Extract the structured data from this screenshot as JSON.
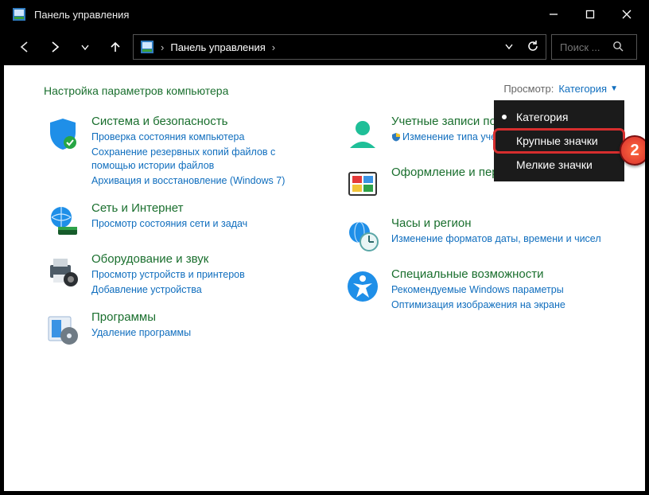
{
  "window": {
    "title": "Панель управления"
  },
  "address": {
    "location": "Панель управления",
    "sep": "›"
  },
  "search": {
    "placeholder": "Поиск ..."
  },
  "page": {
    "heading": "Настройка параметров компьютера",
    "view_label": "Просмотр:",
    "view_value": "Категория"
  },
  "dropdown": {
    "opt1": "Категория",
    "opt2": "Крупные значки",
    "opt3": "Мелкие значки"
  },
  "badge": {
    "num": "2"
  },
  "left": {
    "c1": {
      "title": "Система и безопасность",
      "l1": "Проверка состояния компьютера",
      "l2": "Сохранение резервных копий файлов с помощью истории файлов",
      "l3": "Архивация и восстановление (Windows 7)"
    },
    "c2": {
      "title": "Сеть и Интернет",
      "l1": "Просмотр состояния сети и задач"
    },
    "c3": {
      "title": "Оборудование и звук",
      "l1": "Просмотр устройств и принтеров",
      "l2": "Добавление устройства"
    },
    "c4": {
      "title": "Программы",
      "l1": "Удаление программы"
    }
  },
  "right": {
    "c1": {
      "title": "Учетные записи поль",
      "l1": "Изменение типа учетно"
    },
    "c2": {
      "title": "Оформление и персонализация"
    },
    "c3": {
      "title": "Часы и регион",
      "l1": "Изменение форматов даты, времени и чисел"
    },
    "c4": {
      "title": "Специальные возможности",
      "l1": "Рекомендуемые Windows параметры",
      "l2": "Оптимизация изображения на экране"
    }
  }
}
